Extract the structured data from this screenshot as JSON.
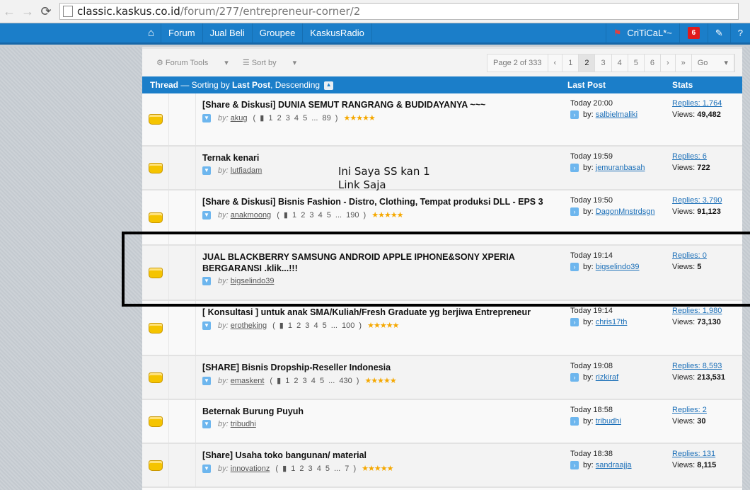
{
  "browser": {
    "url_host": "classic.kaskus.co.id",
    "url_path": "/forum/277/entrepreneur-corner/2",
    "back": "←",
    "forward": "→",
    "reload": "⟳"
  },
  "nav": {
    "items": [
      "Forum",
      "Jual Beli",
      "Groupee",
      "KaskusRadio"
    ],
    "user": "CriTiCaL*~",
    "notifications": "6"
  },
  "toolbar": {
    "forum_tools": "Forum Tools",
    "sort_by": "Sort by",
    "page_info": "Page 2 of 333",
    "pages": [
      "1",
      "2",
      "3",
      "4",
      "5",
      "6"
    ],
    "current_page": "2",
    "go": "Go"
  },
  "header": {
    "thread_bold": "Thread",
    "sorting_text": " — Sorting by ",
    "sort_field": "Last Post",
    "sort_dir": ", Descending",
    "last_post": "Last Post",
    "stats": "Stats"
  },
  "annotation": {
    "line1": "Ini Saya SS kan 1",
    "line2": "Link Saja"
  },
  "threads": [
    {
      "title": "[Share & Diskusi] DUNIA SEMUT RANGRANG & BUDIDAYANYA ~~~",
      "author": "akug",
      "pages": "1 2 3 4 5 ... 89",
      "rating": 5,
      "last_time": "Today 20:00",
      "last_by": "salbielmaliki",
      "replies": "Replies: 1,764",
      "views": "49,482"
    },
    {
      "title": "Ternak kenari",
      "author": "lutfiadam",
      "pages": "",
      "rating": 0,
      "last_time": "Today 19:59",
      "last_by": "jemuranbasah",
      "replies": "Replies: 6",
      "views": "722"
    },
    {
      "title": "[Share & Diskusi] Bisnis Fashion - Distro, Clothing, Tempat produksi DLL - EPS 3",
      "author": "anakmoong",
      "pages": "1 2 3 4 5 ... 190",
      "rating": 5,
      "last_time": "Today 19:50",
      "last_by": "DagonMnstrdsgn",
      "replies": "Replies: 3,790",
      "views": "91,123"
    },
    {
      "title": "JUAL BLACKBERRY SAMSUNG ANDROID APPLE IPHONE&SONY XPERIA BERGARANSI .klik...!!!",
      "author": "bigselindo39",
      "pages": "",
      "rating": 0,
      "last_time": "Today 19:14",
      "last_by": "bigselindo39",
      "replies": "Replies: 0",
      "views": "5"
    },
    {
      "title": "[ Konsultasi ] untuk anak SMA/Kuliah/Fresh Graduate yg berjiwa Entrepreneur",
      "author": "erotheking",
      "pages": "1 2 3 4 5 ... 100",
      "rating": 5,
      "last_time": "Today 19:14",
      "last_by": "chris17th",
      "replies": "Replies: 1,980",
      "views": "73,130"
    },
    {
      "title": "[SHARE] Bisnis Dropship-Reseller Indonesia",
      "author": "emaskent",
      "pages": "1 2 3 4 5 ... 430",
      "rating": 5,
      "last_time": "Today 19:08",
      "last_by": "rizkiraf",
      "replies": "Replies: 8,593",
      "views": "213,531"
    },
    {
      "title": "Beternak Burung Puyuh",
      "author": "tribudhi",
      "pages": "",
      "rating": 0,
      "last_time": "Today 18:58",
      "last_by": "tribudhi",
      "replies": "Replies: 2",
      "views": "30"
    },
    {
      "title": "[Share] Usaha toko bangunan/ material",
      "author": "innovationz",
      "pages": "1 2 3 4 5 ... 7",
      "rating": 5,
      "last_time": "Today 18:38",
      "last_by": "sandraajja",
      "replies": "Replies: 131",
      "views": "8,115"
    }
  ],
  "labels": {
    "by": "by:",
    "views": "Views: "
  },
  "colors": {
    "nav_blue": "#1b7ec9",
    "link_blue": "#1b6fb8",
    "star": "#f5a800",
    "badge_red": "#e01b1b"
  }
}
